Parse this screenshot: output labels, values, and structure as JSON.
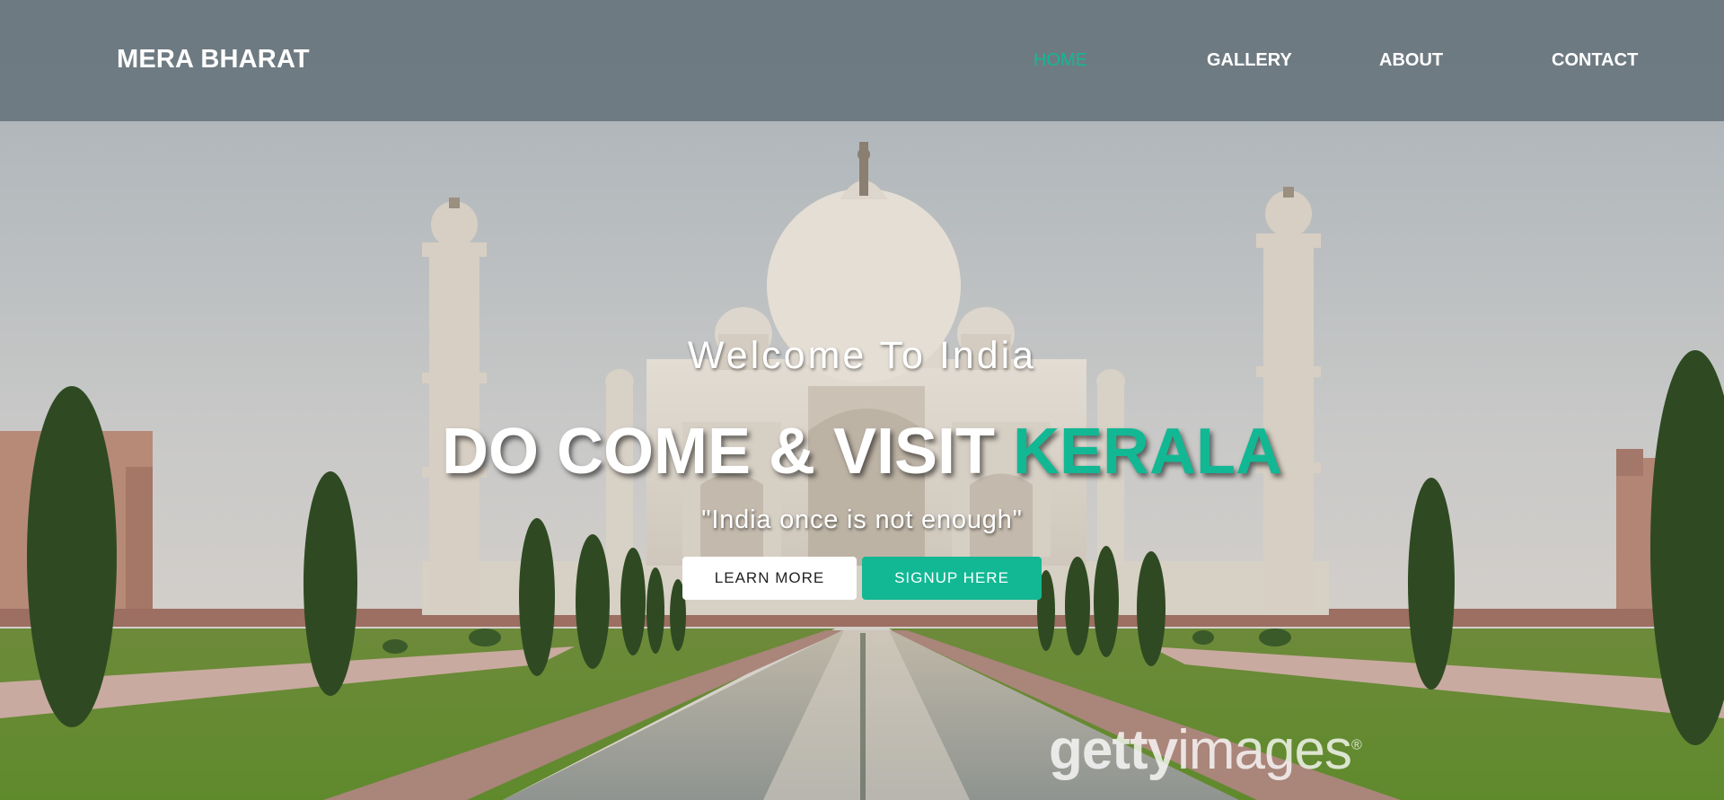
{
  "nav": {
    "brand": "MERA BHARAT",
    "links": [
      {
        "label": "HOME",
        "active": true
      },
      {
        "label": "GALLERY",
        "active": false
      },
      {
        "label": "ABOUT",
        "active": false
      },
      {
        "label": "CONTACT",
        "active": false
      }
    ]
  },
  "hero": {
    "welcome": "Welcome To India",
    "headline_prefix": "DO COME & VISIT ",
    "headline_accent": "KERALA",
    "tagline": "\"India once is not enough\"",
    "learn_more_label": "LEARN MORE",
    "signup_label": "SIGNUP HERE"
  },
  "background": {
    "subject": "taj-mahal-photo",
    "watermark_prefix": "getty",
    "watermark_suffix": "images"
  },
  "colors": {
    "accent": "#12b894",
    "navbar": "#606e76",
    "text": "#ffffff"
  }
}
